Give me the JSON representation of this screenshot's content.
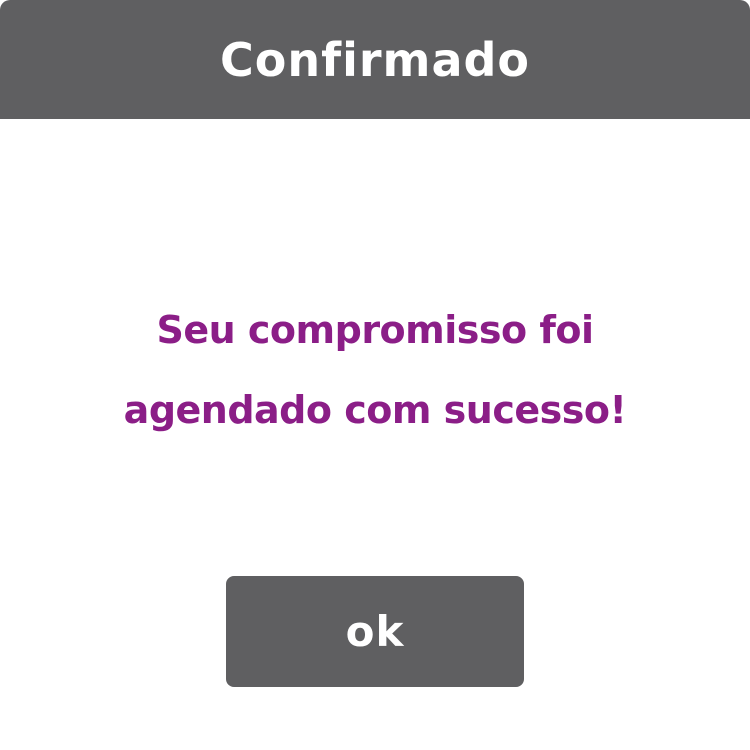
{
  "dialog": {
    "title": "Confirmado",
    "message_lines": [
      "Seu compromisso foi",
      "agendado com sucesso!"
    ],
    "ok_label": "ok"
  },
  "colors": {
    "header_background": "#5f5f61",
    "button_background": "#5f5f61",
    "message_text": "#8b1e87",
    "title_text": "#ffffff",
    "dialog_background": "#ffffff"
  }
}
